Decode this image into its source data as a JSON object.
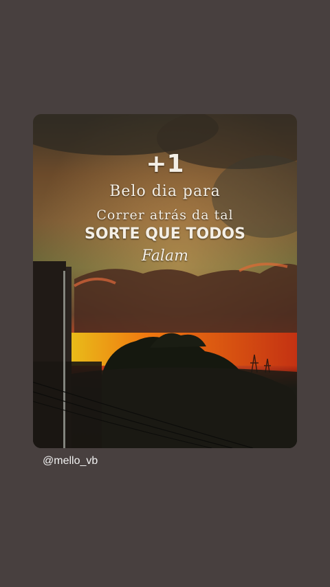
{
  "post": {
    "badge": "+1",
    "lines": [
      "Belo dia para",
      "Correr atrás da tal",
      "SORTE QUE TODOS",
      "Falam"
    ]
  },
  "author": {
    "handle": "@mello_vb"
  }
}
